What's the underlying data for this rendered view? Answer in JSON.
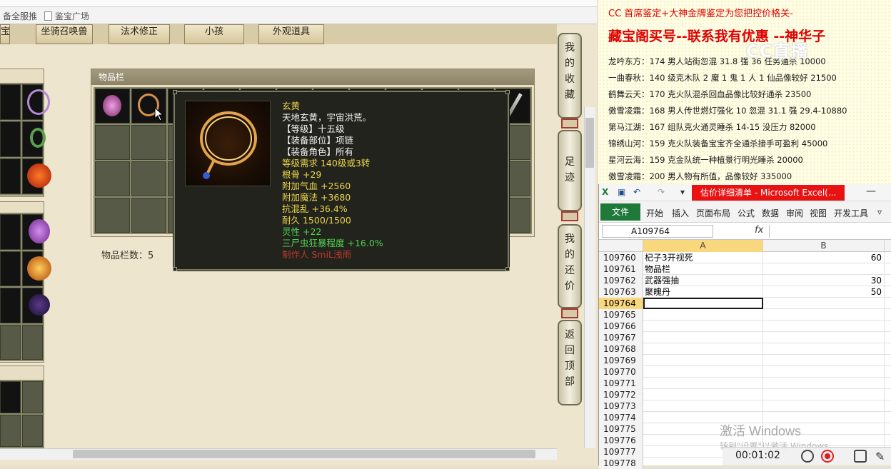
{
  "browser": {
    "bookmarks": [
      {
        "label": "备全服推"
      },
      {
        "label": "鉴宝广场"
      }
    ]
  },
  "game": {
    "tabs": [
      "宝",
      "坐骑召唤兽",
      "法术修正",
      "小孩",
      "外观道具"
    ],
    "inventory": {
      "title": "物品栏",
      "count_label": "物品栏数：5"
    },
    "tooltip": {
      "lines": [
        {
          "text": "玄黄",
          "color": "#e8d44a"
        },
        {
          "text": "天地玄黄，宇宙洪荒。",
          "color": "#f2f2f2"
        },
        {
          "text": "【等级】十五级",
          "color": "#f2f2f2"
        },
        {
          "text": "【装备部位】项链",
          "color": "#f2f2f2"
        },
        {
          "text": "【装备角色】所有",
          "color": "#f2f2f2"
        },
        {
          "text": "等级需求 140级或3转",
          "color": "#e8d44a"
        },
        {
          "text": "根骨 +29",
          "color": "#e8d44a"
        },
        {
          "text": "附加气血 +2560",
          "color": "#e8d44a"
        },
        {
          "text": "附加魔法 +3680",
          "color": "#e8d44a"
        },
        {
          "text": "抗混乱 +36.4%",
          "color": "#e8d44a"
        },
        {
          "text": "耐久 1500/1500",
          "color": "#e8d44a"
        },
        {
          "text": "灵性 +22",
          "color": "#4fd04f"
        },
        {
          "text": "三尸虫狂暴程度 +16.0%",
          "color": "#4fd04f"
        },
        {
          "text": "制作人 SmiL浅雨",
          "color": "#c0392b"
        }
      ]
    },
    "side_nav": [
      {
        "label": "我的收藏"
      },
      {
        "label": "足迹"
      },
      {
        "label": "我的还价"
      },
      {
        "label": "返回顶部"
      }
    ]
  },
  "doc": {
    "heading1": "CC 首席鉴定+大神金牌鉴定为您把控价格关-",
    "heading2": "藏宝阁买号--联系我有优惠 --神华子",
    "lines": [
      "龙吟东方：174 男人站街忽混 31.8 强 36 任务通杀 10000",
      "一曲春秋：140 级克木队 2 魔 1 鬼 1 人 1 仙品像较好 21500",
      "鹤舞云天：170 克火队混杀回血品像比较好通杀 23500",
      "傲雪凌霜：168 男人传世燃灯强化 10 忽混 31.1 强 29.4-10880",
      "第马江湖：167 组队克火通灵睡杀 14-15 没压力 82000",
      "锦绣山河：159 克火队装备宝宝齐全通杀接手可盈利 45000",
      "星河云海：159 克金队统一种植景行明光睡杀 20000",
      "傲雪凌霜：200 男人物有所值，品像较好 335000"
    ],
    "watermark": "CC直播"
  },
  "excel": {
    "title": "估价详细清单 - Microsoft Excel(...",
    "file_tab": "文件",
    "ribbon_tabs": [
      "开始",
      "插入",
      "页面布局",
      "公式",
      "数据",
      "审阅",
      "视图",
      "开发工具"
    ],
    "name_box": "A109764",
    "fx": "fx",
    "columns": [
      "A",
      "B"
    ],
    "rows": [
      {
        "num": "109760",
        "a": "杞子3开视死",
        "b": "60"
      },
      {
        "num": "109761",
        "a": "物品栏",
        "b": ""
      },
      {
        "num": "109762",
        "a": "武器强抽",
        "b": "30"
      },
      {
        "num": "109763",
        "a": "聚魄丹",
        "b": "50"
      },
      {
        "num": "109764",
        "a": "",
        "b": ""
      },
      {
        "num": "109765",
        "a": "",
        "b": ""
      },
      {
        "num": "109766",
        "a": "",
        "b": ""
      },
      {
        "num": "109767",
        "a": "",
        "b": ""
      },
      {
        "num": "109768",
        "a": "",
        "b": ""
      },
      {
        "num": "109769",
        "a": "",
        "b": ""
      },
      {
        "num": "109770",
        "a": "",
        "b": ""
      },
      {
        "num": "109771",
        "a": "",
        "b": ""
      },
      {
        "num": "109772",
        "a": "",
        "b": ""
      },
      {
        "num": "109773",
        "a": "",
        "b": ""
      },
      {
        "num": "109774",
        "a": "",
        "b": ""
      },
      {
        "num": "109775",
        "a": "",
        "b": ""
      },
      {
        "num": "109776",
        "a": "",
        "b": ""
      },
      {
        "num": "109777",
        "a": "",
        "b": ""
      },
      {
        "num": "109778",
        "a": "",
        "b": ""
      }
    ],
    "active_row_index": 4
  },
  "os": {
    "activate_title": "激活 Windows",
    "activate_sub": "转到\"设置\"以激活 Windows。",
    "recorder_time": "00:01:02"
  }
}
